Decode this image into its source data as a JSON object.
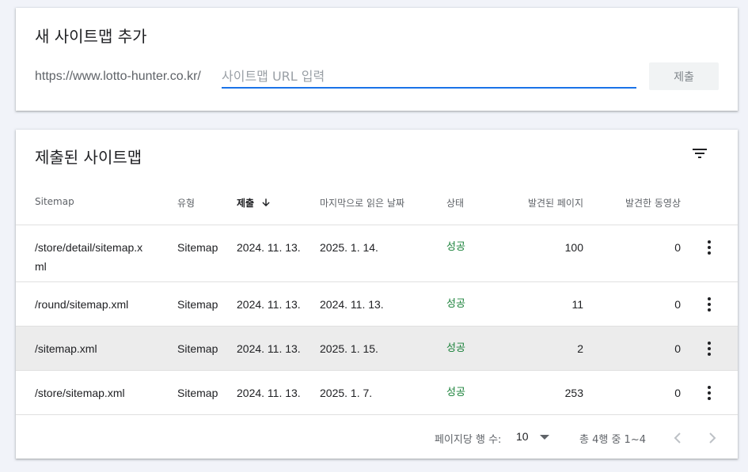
{
  "add_sitemap": {
    "title": "새 사이트맵 추가",
    "url_prefix": "https://www.lotto-hunter.co.kr/",
    "input_placeholder": "사이트맵 URL 입력",
    "input_value": "",
    "submit_label": "제출"
  },
  "submitted": {
    "title": "제출된 사이트맵",
    "columns": {
      "sitemap": "Sitemap",
      "type": "유형",
      "submitted": "제출",
      "last_read": "마지막으로 읽은 날짜",
      "status": "상태",
      "pages": "발견된 페이지",
      "videos": "발견한 동영상"
    },
    "rows": [
      {
        "sitemap_line1": "/store/detail/sitemap.x",
        "sitemap_line2": "ml",
        "type": "Sitemap",
        "submitted": "2024. 11. 13.",
        "last_read": "2025. 1. 14.",
        "status": "성공",
        "pages": "100",
        "videos": "0"
      },
      {
        "sitemap_line1": "/round/sitemap.xml",
        "sitemap_line2": "",
        "type": "Sitemap",
        "submitted": "2024. 11. 13.",
        "last_read": "2024. 11. 13.",
        "status": "성공",
        "pages": "11",
        "videos": "0"
      },
      {
        "sitemap_line1": "/sitemap.xml",
        "sitemap_line2": "",
        "type": "Sitemap",
        "submitted": "2024. 11. 13.",
        "last_read": "2025. 1. 15.",
        "status": "성공",
        "pages": "2",
        "videos": "0"
      },
      {
        "sitemap_line1": "/store/sitemap.xml",
        "sitemap_line2": "",
        "type": "Sitemap",
        "submitted": "2024. 11. 13.",
        "last_read": "2025. 1. 7.",
        "status": "성공",
        "pages": "253",
        "videos": "0"
      }
    ],
    "pagination": {
      "rows_per_page_label": "페이지당 행 수:",
      "rows_per_page_value": "10",
      "range_text": "총 4행 중 1~4"
    }
  },
  "colors": {
    "accent": "#1a73e8",
    "success": "#188038",
    "highlight_row": "#ececec",
    "background": "#f1f3f9"
  },
  "icons": [
    "filter-icon",
    "arrow-down-icon",
    "more-vert-icon",
    "chevron-down-icon",
    "chevron-left-icon",
    "chevron-right-icon"
  ]
}
